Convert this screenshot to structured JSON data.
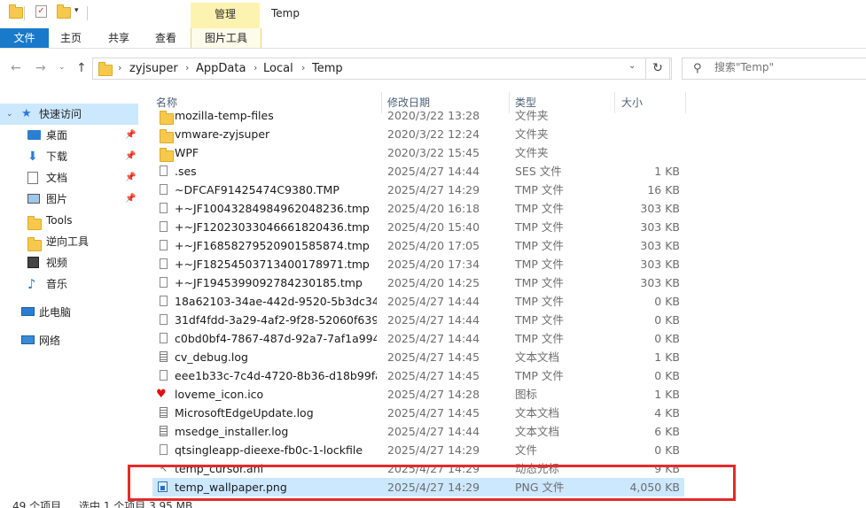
{
  "titlebar": {
    "title": "Temp",
    "manage_tab": "管理"
  },
  "ribbon": {
    "tabs": [
      "文件",
      "主页",
      "共享",
      "查看",
      "图片工具"
    ]
  },
  "address": {
    "crumbs": [
      "zyjsuper",
      "AppData",
      "Local",
      "Temp"
    ],
    "search_placeholder": "搜索\"Temp\""
  },
  "nav": {
    "quick_access": "快速访问",
    "items": [
      "桌面",
      "下载",
      "文档",
      "图片",
      "Tools",
      "逆向工具",
      "视频",
      "音乐"
    ],
    "this_pc": "此电脑",
    "network": "网络"
  },
  "columns": {
    "name": "名称",
    "date": "修改日期",
    "type": "类型",
    "size": "大小"
  },
  "files": [
    {
      "name": "mozilla-temp-files",
      "date": "2020/3/22 13:28",
      "type": "文件夹",
      "size": "",
      "icon": "folder-icon"
    },
    {
      "name": "vmware-zyjsuper",
      "date": "2020/3/22 12:24",
      "type": "文件夹",
      "size": "",
      "icon": "folder-icon"
    },
    {
      "name": "WPF",
      "date": "2020/3/22 15:45",
      "type": "文件夹",
      "size": "",
      "icon": "folder-icon"
    },
    {
      "name": ".ses",
      "date": "2025/4/27 14:44",
      "type": "SES 文件",
      "size": "1 KB",
      "icon": "file-icon"
    },
    {
      "name": "~DFCAF91425474C9380.TMP",
      "date": "2025/4/27 14:29",
      "type": "TMP 文件",
      "size": "16 KB",
      "icon": "file-icon"
    },
    {
      "name": "+~JF10043284984962048236.tmp",
      "date": "2025/4/20 16:18",
      "type": "TMP 文件",
      "size": "303 KB",
      "icon": "file-icon"
    },
    {
      "name": "+~JF12023033046661820436.tmp",
      "date": "2025/4/20 15:40",
      "type": "TMP 文件",
      "size": "303 KB",
      "icon": "file-icon"
    },
    {
      "name": "+~JF16858279520901585874.tmp",
      "date": "2025/4/20 17:05",
      "type": "TMP 文件",
      "size": "303 KB",
      "icon": "file-icon"
    },
    {
      "name": "+~JF18254503713400178971.tmp",
      "date": "2025/4/20 17:34",
      "type": "TMP 文件",
      "size": "303 KB",
      "icon": "file-icon"
    },
    {
      "name": "+~JF1945399092784230185.tmp",
      "date": "2025/4/20 14:25",
      "type": "TMP 文件",
      "size": "303 KB",
      "icon": "file-icon"
    },
    {
      "name": "18a62103-34ae-442d-9520-5b3dc34...",
      "date": "2025/4/27 14:44",
      "type": "TMP 文件",
      "size": "0 KB",
      "icon": "file-icon"
    },
    {
      "name": "31df4fdd-3a29-4af2-9f28-52060f639...",
      "date": "2025/4/27 14:44",
      "type": "TMP 文件",
      "size": "0 KB",
      "icon": "file-icon"
    },
    {
      "name": "c0bd0bf4-7867-487d-92a7-7af1a994...",
      "date": "2025/4/27 14:44",
      "type": "TMP 文件",
      "size": "0 KB",
      "icon": "file-icon"
    },
    {
      "name": "cv_debug.log",
      "date": "2025/4/27 14:45",
      "type": "文本文档",
      "size": "1 KB",
      "icon": "text-file-icon"
    },
    {
      "name": "eee1b33c-7c4d-4720-8b36-d18b99fa...",
      "date": "2025/4/27 14:45",
      "type": "TMP 文件",
      "size": "0 KB",
      "icon": "file-icon"
    },
    {
      "name": "loveme_icon.ico",
      "date": "2025/4/27 14:28",
      "type": "图标",
      "size": "1 KB",
      "icon": "heart-icon"
    },
    {
      "name": "MicrosoftEdgeUpdate.log",
      "date": "2025/4/27 14:45",
      "type": "文本文档",
      "size": "4 KB",
      "icon": "text-file-icon"
    },
    {
      "name": "msedge_installer.log",
      "date": "2025/4/27 14:44",
      "type": "文本文档",
      "size": "6 KB",
      "icon": "text-file-icon"
    },
    {
      "name": "qtsingleapp-dieexe-fb0c-1-lockfile",
      "date": "2025/4/27 14:29",
      "type": "文件",
      "size": "0 KB",
      "icon": "file-icon"
    },
    {
      "name": "temp_cursor.ani",
      "date": "2025/4/27 14:29",
      "type": "动态光标",
      "size": "9 KB",
      "icon": "cursor-icon"
    },
    {
      "name": "temp_wallpaper.png",
      "date": "2025/4/27 14:29",
      "type": "PNG 文件",
      "size": "4,050 KB",
      "icon": "image-icon"
    }
  ],
  "status": {
    "count": "49 个项目",
    "selection": "选中 1 个项目 3.95 MB"
  },
  "colors": {
    "accent": "#1979ca",
    "selection": "#cce8ff",
    "highlight_box": "#e62a2a",
    "manage_tab": "#fdf3b1"
  }
}
